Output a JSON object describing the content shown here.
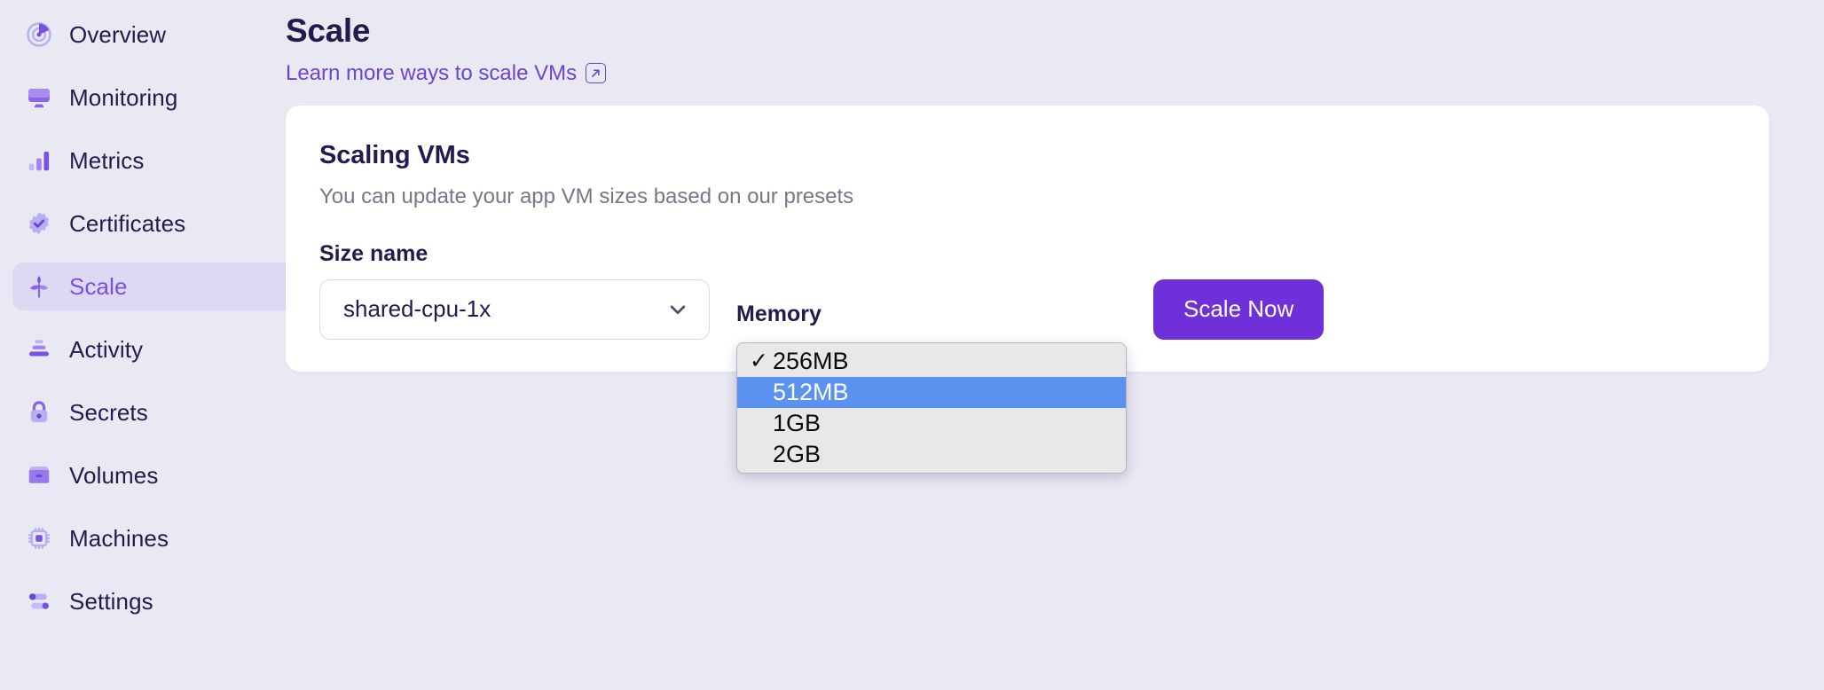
{
  "sidebar": {
    "items": [
      {
        "label": "Overview",
        "icon": "overview-pie-icon",
        "active": false
      },
      {
        "label": "Monitoring",
        "icon": "monitor-icon",
        "active": false
      },
      {
        "label": "Metrics",
        "icon": "bar-chart-icon",
        "active": false
      },
      {
        "label": "Certificates",
        "icon": "badge-check-icon",
        "active": false
      },
      {
        "label": "Scale",
        "icon": "leaf-sprout-icon",
        "active": true
      },
      {
        "label": "Activity",
        "icon": "stack-layers-icon",
        "active": false
      },
      {
        "label": "Secrets",
        "icon": "lock-icon",
        "active": false
      },
      {
        "label": "Volumes",
        "icon": "box-icon",
        "active": false
      },
      {
        "label": "Machines",
        "icon": "cpu-chip-icon",
        "active": false
      },
      {
        "label": "Settings",
        "icon": "sliders-toggle-icon",
        "active": false
      }
    ]
  },
  "header": {
    "title": "Scale",
    "learn_link": "Learn more ways to scale VMs",
    "learn_link_icon": "external-link-icon"
  },
  "card": {
    "title": "Scaling VMs",
    "subtitle": "You can update your app VM sizes based on our presets"
  },
  "form": {
    "size_name_label": "Size name",
    "size_name_value": "shared-cpu-1x",
    "size_name_chevron": "chevron-down-icon",
    "memory_label": "Memory",
    "memory_options": [
      {
        "label": "256MB",
        "checked": true,
        "highlighted": false
      },
      {
        "label": "512MB",
        "checked": false,
        "highlighted": true
      },
      {
        "label": "1GB",
        "checked": false,
        "highlighted": false
      },
      {
        "label": "2GB",
        "checked": false,
        "highlighted": false
      }
    ],
    "check_glyph": "✓",
    "scale_now_label": "Scale Now"
  },
  "colors": {
    "page_bg": "#e9e9f3",
    "accent_purple": "#6f30da",
    "link_purple": "#6d43d4",
    "active_nav_bg": "#ddd9f2",
    "text_dark": "#241a4e",
    "muted_text": "#77778c",
    "dropdown_bg": "#e8e8e8",
    "dropdown_highlight": "#5b92f0",
    "card_bg": "#ffffff"
  }
}
